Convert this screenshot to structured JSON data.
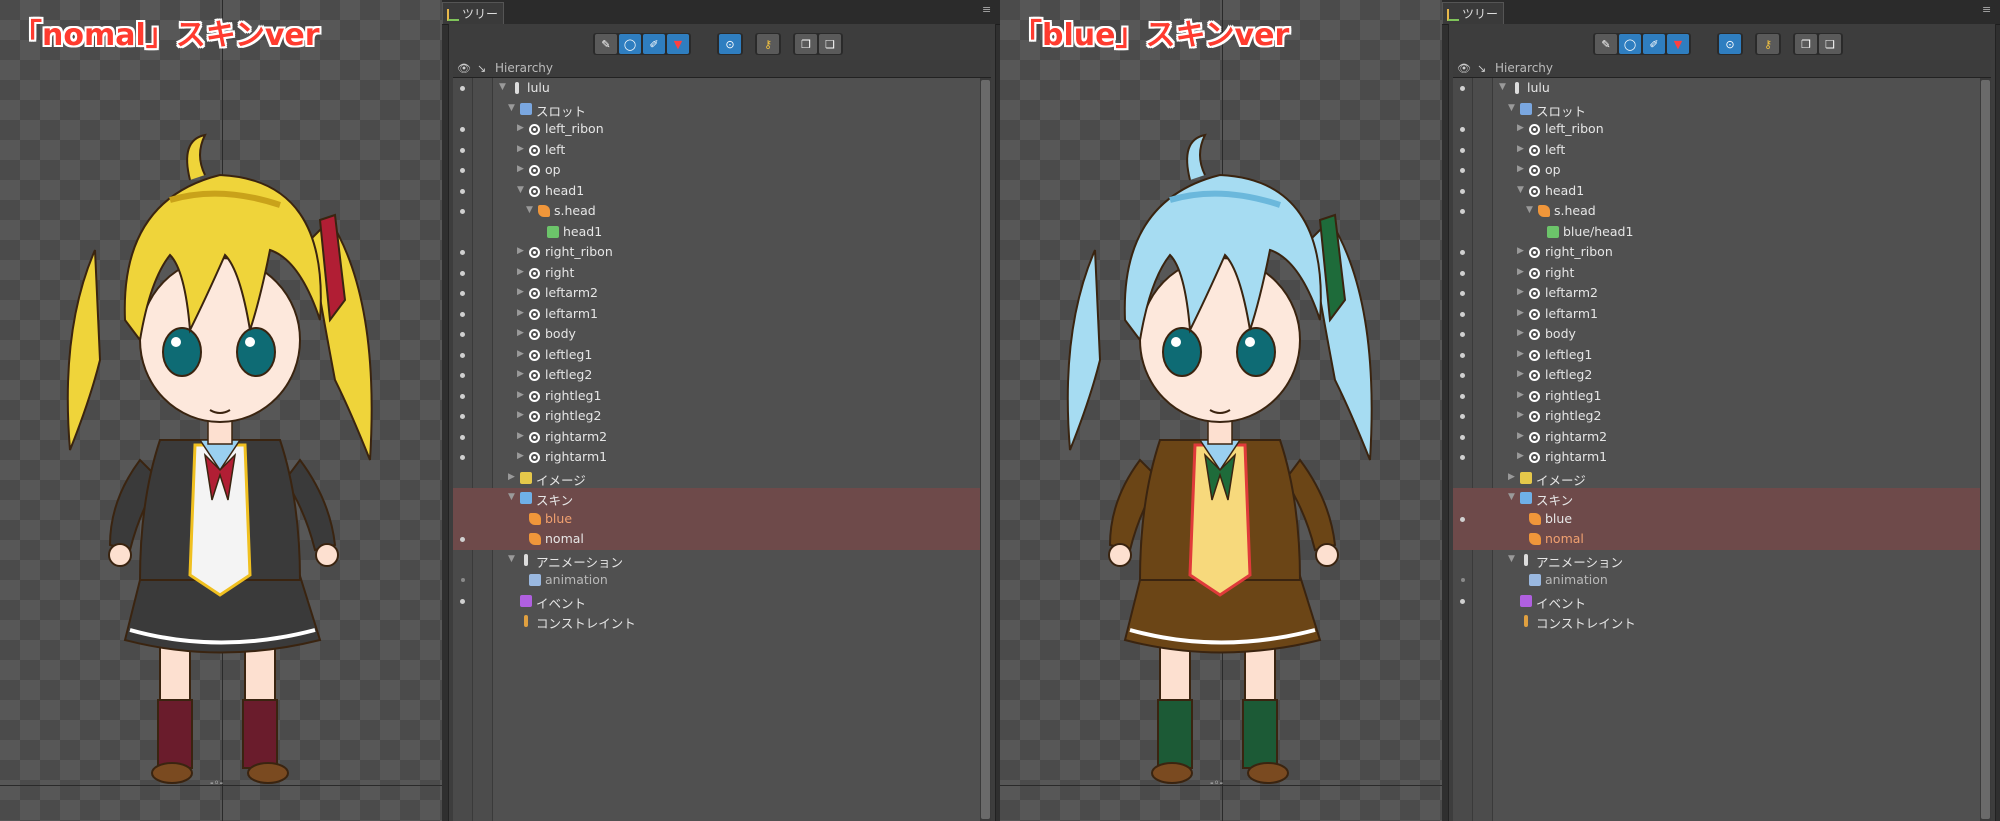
{
  "left": {
    "caption": "「nomal」スキンver",
    "colors": {
      "hair": "#efd43a",
      "hair_dark": "#c9a21a",
      "coat": "#3a3a3a",
      "vest": "#f4f4f4",
      "ribbon": "#b11e34",
      "skirt": "#3a3a3a",
      "socks": "#6a1c2c",
      "trim": "#f0c020"
    }
  },
  "right": {
    "caption": "「blue」スキンver",
    "colors": {
      "hair": "#a6dcf2",
      "hair_dark": "#6bb8dc",
      "coat": "#6b4516",
      "vest": "#f7d97c",
      "ribbon": "#1e6b3a",
      "skirt": "#6b4516",
      "socks": "#1c5a36",
      "trim": "#e03a3a"
    }
  },
  "panel": {
    "tab_label": "ツリー",
    "menu_icon": "menu-icon",
    "tree_header": "Hierarchy",
    "toolbar_icons": [
      "pen-icon",
      "circle-icon",
      "pencil-icon",
      "filter-icon",
      "target-icon",
      "key-icon",
      "copy-icon",
      "paste-icon"
    ]
  },
  "tree_left": [
    {
      "label": "lulu",
      "depth": 0,
      "arrow": "▼",
      "icon": "root",
      "dot": true
    },
    {
      "label": "スロット",
      "depth": 1,
      "arrow": "▼",
      "icon": "slots",
      "dot": false
    },
    {
      "label": "left_ribon",
      "depth": 2,
      "arrow": "▶",
      "icon": "slot",
      "dot": true
    },
    {
      "label": "left",
      "depth": 2,
      "arrow": "▶",
      "icon": "slot",
      "dot": true
    },
    {
      "label": "op",
      "depth": 2,
      "arrow": "▶",
      "icon": "slot",
      "dot": true
    },
    {
      "label": "head1",
      "depth": 2,
      "arrow": "▼",
      "icon": "slot",
      "dot": true
    },
    {
      "label": "s.head",
      "depth": 3,
      "arrow": "▼",
      "icon": "skinph",
      "dot": true
    },
    {
      "label": "head1",
      "depth": 4,
      "arrow": "",
      "icon": "image",
      "dot": false
    },
    {
      "label": "right_ribon",
      "depth": 2,
      "arrow": "▶",
      "icon": "slot",
      "dot": true
    },
    {
      "label": "right",
      "depth": 2,
      "arrow": "▶",
      "icon": "slot",
      "dot": true
    },
    {
      "label": "leftarm2",
      "depth": 2,
      "arrow": "▶",
      "icon": "slot",
      "dot": true
    },
    {
      "label": "leftarm1",
      "depth": 2,
      "arrow": "▶",
      "icon": "slot",
      "dot": true
    },
    {
      "label": "body",
      "depth": 2,
      "arrow": "▶",
      "icon": "slot",
      "dot": true
    },
    {
      "label": "leftleg1",
      "depth": 2,
      "arrow": "▶",
      "icon": "slot",
      "dot": true
    },
    {
      "label": "leftleg2",
      "depth": 2,
      "arrow": "▶",
      "icon": "slot",
      "dot": true
    },
    {
      "label": "rightleg1",
      "depth": 2,
      "arrow": "▶",
      "icon": "slot",
      "dot": true
    },
    {
      "label": "rightleg2",
      "depth": 2,
      "arrow": "▶",
      "icon": "slot",
      "dot": true
    },
    {
      "label": "rightarm2",
      "depth": 2,
      "arrow": "▶",
      "icon": "slot",
      "dot": true
    },
    {
      "label": "rightarm1",
      "depth": 2,
      "arrow": "▶",
      "icon": "slot",
      "dot": true
    },
    {
      "label": "イメージ",
      "depth": 1,
      "arrow": "▶",
      "icon": "images",
      "dot": false
    },
    {
      "label": "スキン",
      "depth": 1,
      "arrow": "▼",
      "icon": "skins",
      "dot": false,
      "hl": true
    },
    {
      "label": "blue",
      "depth": 2,
      "arrow": "",
      "icon": "skin",
      "dot": false,
      "hl": true,
      "style": "orange"
    },
    {
      "label": "nomal",
      "depth": 2,
      "arrow": "",
      "icon": "skin",
      "dot": true,
      "hl": true,
      "style": "white"
    },
    {
      "label": "アニメーション",
      "depth": 1,
      "arrow": "▼",
      "icon": "anims",
      "dot": false
    },
    {
      "label": "animation",
      "depth": 2,
      "arrow": "",
      "icon": "anim",
      "dot": false,
      "dimdot": true,
      "style": "dim"
    },
    {
      "label": "イベント",
      "depth": 1,
      "arrow": "",
      "icon": "events",
      "dot": true
    },
    {
      "label": "コンストレイント",
      "depth": 1,
      "arrow": "",
      "icon": "constraints",
      "dot": false
    }
  ],
  "tree_right": [
    {
      "label": "lulu",
      "depth": 0,
      "arrow": "▼",
      "icon": "root",
      "dot": true
    },
    {
      "label": "スロット",
      "depth": 1,
      "arrow": "▼",
      "icon": "slots",
      "dot": false
    },
    {
      "label": "left_ribon",
      "depth": 2,
      "arrow": "▶",
      "icon": "slot",
      "dot": true
    },
    {
      "label": "left",
      "depth": 2,
      "arrow": "▶",
      "icon": "slot",
      "dot": true
    },
    {
      "label": "op",
      "depth": 2,
      "arrow": "▶",
      "icon": "slot",
      "dot": true
    },
    {
      "label": "head1",
      "depth": 2,
      "arrow": "▼",
      "icon": "slot",
      "dot": true
    },
    {
      "label": "s.head",
      "depth": 3,
      "arrow": "▼",
      "icon": "skinph",
      "dot": true
    },
    {
      "label": "blue/head1",
      "depth": 4,
      "arrow": "",
      "icon": "image",
      "dot": false
    },
    {
      "label": "right_ribon",
      "depth": 2,
      "arrow": "▶",
      "icon": "slot",
      "dot": true
    },
    {
      "label": "right",
      "depth": 2,
      "arrow": "▶",
      "icon": "slot",
      "dot": true
    },
    {
      "label": "leftarm2",
      "depth": 2,
      "arrow": "▶",
      "icon": "slot",
      "dot": true
    },
    {
      "label": "leftarm1",
      "depth": 2,
      "arrow": "▶",
      "icon": "slot",
      "dot": true
    },
    {
      "label": "body",
      "depth": 2,
      "arrow": "▶",
      "icon": "slot",
      "dot": true
    },
    {
      "label": "leftleg1",
      "depth": 2,
      "arrow": "▶",
      "icon": "slot",
      "dot": true
    },
    {
      "label": "leftleg2",
      "depth": 2,
      "arrow": "▶",
      "icon": "slot",
      "dot": true
    },
    {
      "label": "rightleg1",
      "depth": 2,
      "arrow": "▶",
      "icon": "slot",
      "dot": true
    },
    {
      "label": "rightleg2",
      "depth": 2,
      "arrow": "▶",
      "icon": "slot",
      "dot": true
    },
    {
      "label": "rightarm2",
      "depth": 2,
      "arrow": "▶",
      "icon": "slot",
      "dot": true
    },
    {
      "label": "rightarm1",
      "depth": 2,
      "arrow": "▶",
      "icon": "slot",
      "dot": true
    },
    {
      "label": "イメージ",
      "depth": 1,
      "arrow": "▶",
      "icon": "images",
      "dot": false
    },
    {
      "label": "スキン",
      "depth": 1,
      "arrow": "▼",
      "icon": "skins",
      "dot": false,
      "hl": true
    },
    {
      "label": "blue",
      "depth": 2,
      "arrow": "",
      "icon": "skin",
      "dot": true,
      "hl": true,
      "style": "white"
    },
    {
      "label": "nomal",
      "depth": 2,
      "arrow": "",
      "icon": "skin",
      "dot": false,
      "hl": true,
      "style": "orange"
    },
    {
      "label": "アニメーション",
      "depth": 1,
      "arrow": "▼",
      "icon": "anims",
      "dot": false
    },
    {
      "label": "animation",
      "depth": 2,
      "arrow": "",
      "icon": "anim",
      "dot": false,
      "dimdot": true,
      "style": "dim"
    },
    {
      "label": "イベント",
      "depth": 1,
      "arrow": "",
      "icon": "events",
      "dot": true
    },
    {
      "label": "コンストレイント",
      "depth": 1,
      "arrow": "",
      "icon": "constraints",
      "dot": false
    }
  ]
}
